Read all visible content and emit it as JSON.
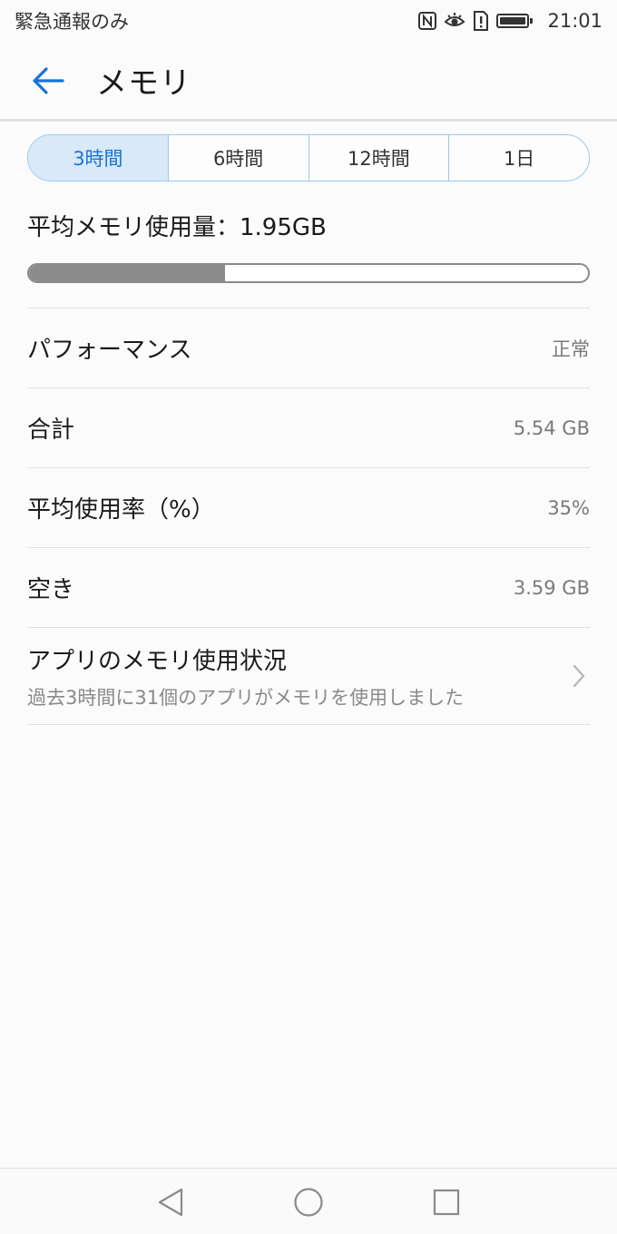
{
  "status_bar": {
    "carrier": "緊急通報のみ",
    "time": "21:01",
    "icons": [
      "nfc-icon",
      "eye-comfort-icon",
      "sim-alert-icon",
      "battery-icon"
    ],
    "battery_level": 1.0
  },
  "app_bar": {
    "title": "メモリ",
    "back_icon": "arrow-left-icon",
    "accent_color": "#1874d6"
  },
  "time_tabs": [
    {
      "label": "3時間",
      "selected": true
    },
    {
      "label": "6時間",
      "selected": false
    },
    {
      "label": "12時間",
      "selected": false
    },
    {
      "label": "1日",
      "selected": false
    }
  ],
  "average": {
    "label": "平均メモリ使用量：1.95GB",
    "usage_fraction": 0.35
  },
  "rows": [
    {
      "label": "パフォーマンス",
      "value": "正常"
    },
    {
      "label": "合計",
      "value": "5.54 GB"
    },
    {
      "label": "平均使用率（%）",
      "value": "35%"
    },
    {
      "label": "空き",
      "value": "3.59 GB"
    }
  ],
  "app_usage": {
    "title": "アプリのメモリ使用状況",
    "subtitle": "過去3時間に31個のアプリがメモリを使用しました",
    "icon": "chevron-right-icon"
  },
  "nav_bar": {
    "buttons": [
      "back-triangle-icon",
      "home-circle-icon",
      "recents-square-icon"
    ]
  }
}
